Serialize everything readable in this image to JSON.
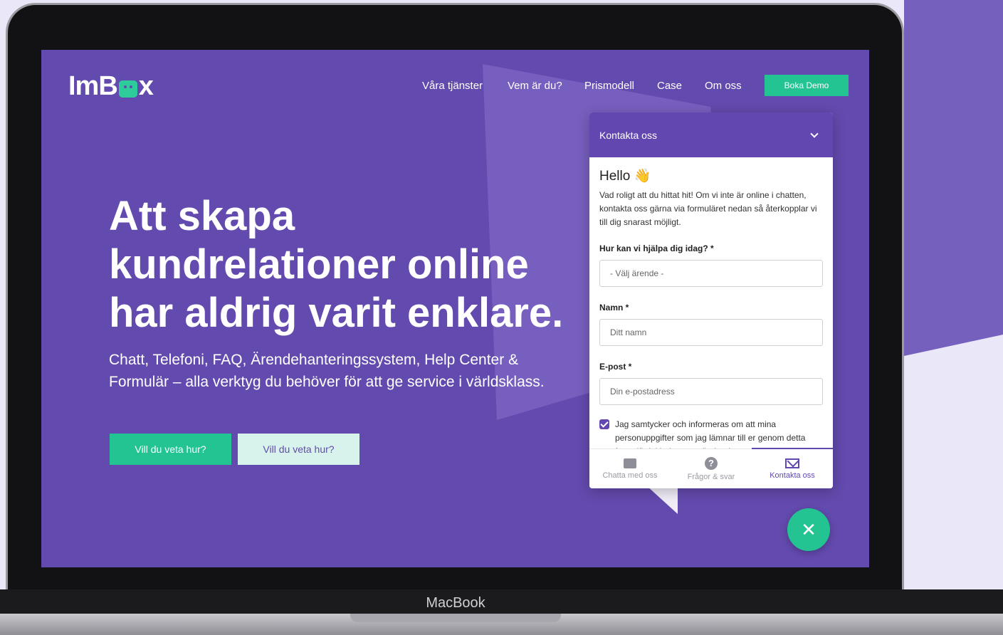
{
  "brand": {
    "logo_pre": "ImB",
    "logo_post": "x"
  },
  "nav": {
    "items": [
      "Våra tjänster",
      "Vem är du?",
      "Prismodell",
      "Case",
      "Om oss"
    ],
    "cta": "Boka Demo"
  },
  "hero": {
    "headline_1": "Att skapa",
    "headline_2": "kundrelationer online",
    "headline_3": "har aldrig varit enklare.",
    "subtext_1": "Chatt, Telefoni, FAQ, Ärendehanteringssystem, Help Center &",
    "subtext_2": "Formulär – alla verktyg du behöver för att ge service i världsklass.",
    "cta_primary": "Vill du veta hur?",
    "cta_secondary": "Vill du veta hur?"
  },
  "widget": {
    "title": "Kontakta oss",
    "greeting": "Hello 👋",
    "intro": "Vad roligt att du hittat hit! Om vi inte är online i chatten, kontakta oss gärna via formuläret nedan så återkopplar vi till dig snarast möjligt.",
    "q1_label": "Hur kan vi hjälpa dig idag? *",
    "q1_placeholder": "- Välj ärende -",
    "name_label": "Namn *",
    "name_placeholder": "Ditt namn",
    "email_label": "E-post *",
    "email_placeholder": "Din e-postadress",
    "consent": "Jag samtycker och informeras om att mina personuppgifter som jag lämnar till er genom detta formulär inkluderat användandet av",
    "tabs": [
      "Chatta med oss",
      "Frågor & svar",
      "Kontakta oss"
    ]
  },
  "device": {
    "label": "MacBook"
  }
}
